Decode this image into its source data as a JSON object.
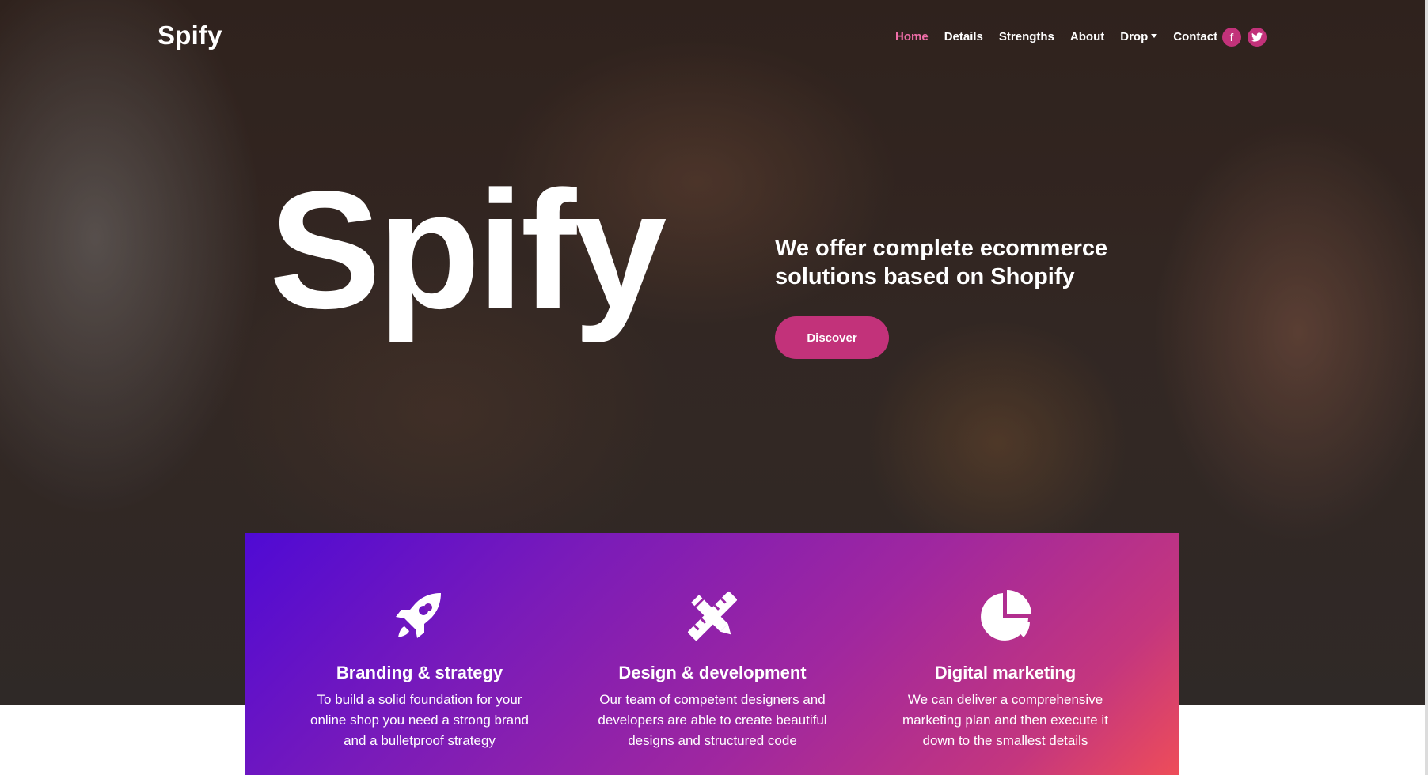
{
  "navbar": {
    "brand": "Spify",
    "links": [
      {
        "label": "Home",
        "active": true
      },
      {
        "label": "Details"
      },
      {
        "label": "Strengths"
      },
      {
        "label": "About"
      },
      {
        "label": "Drop"
      },
      {
        "label": "Contact"
      }
    ],
    "social": [
      {
        "icon": "facebook-icon",
        "glyph": "f"
      },
      {
        "icon": "twitter-icon",
        "glyph": "t"
      }
    ]
  },
  "hero": {
    "title": "Spify",
    "tagline": "We offer complete ecommerce solutions based on Shopify",
    "cta_label": "Discover"
  },
  "features": [
    {
      "icon": "rocket-icon",
      "title": "Branding & strategy",
      "description": "To build a solid foundation for your online shop you need a strong brand and a bulletproof strategy"
    },
    {
      "icon": "pencil-ruler-icon",
      "title": "Design & development",
      "description": "Our team of competent designers and developers are able to create beautiful designs and structured code"
    },
    {
      "icon": "pie-chart-icon",
      "title": "Digital marketing",
      "description": "We can deliver a comprehensive marketing plan and then execute it down to the smallest details"
    }
  ],
  "colors": {
    "accent": "#c2327a",
    "active_link": "#f06ea9",
    "gradient_start": "#4f0ad4",
    "gradient_end": "#ee4d59"
  }
}
